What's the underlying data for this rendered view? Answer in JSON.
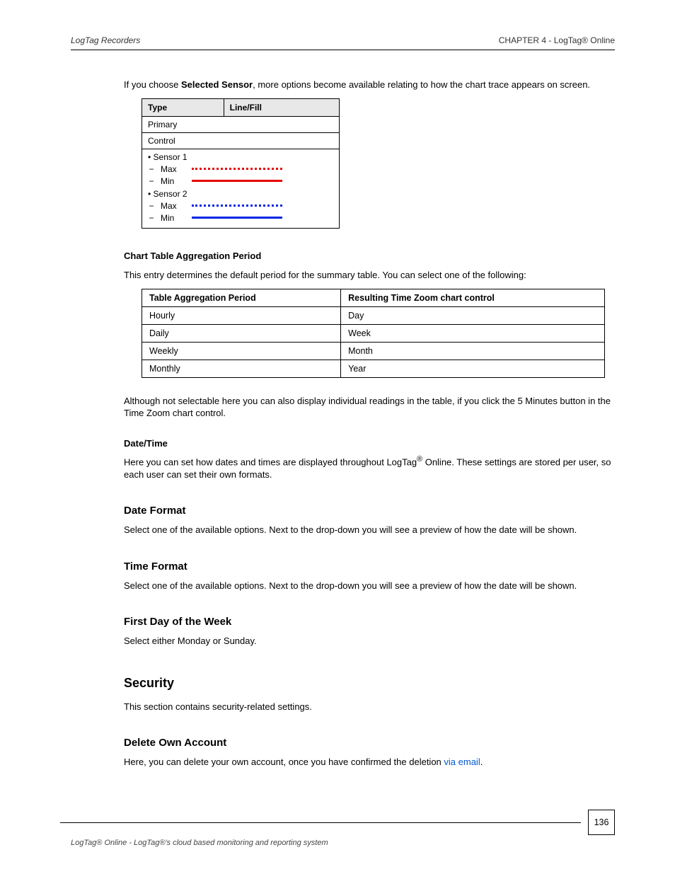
{
  "header": {
    "left": "LogTag Recorders",
    "right": "CHAPTER 4 - LogTag® Online"
  },
  "body": {
    "p1_prefix": "If you choose",
    "p1_bold": "Selected Sensor",
    "p1_suffix": ", more options become available relating to how the chart trace appears on screen.",
    "table1": {
      "header_type": "Type",
      "header_line": "Line/Fill",
      "row1": "Primary",
      "row2": "Control",
      "sensor1_label": "Sensor 1",
      "sub_max": "Max",
      "sub_min": "Min",
      "sensor2_label": "Sensor 2"
    },
    "bold_title1": "Chart Table Aggregation Period",
    "p2": "This entry determines the default period for the summary table. You can select one of the following:",
    "table2": {
      "h1": "Table Aggregation Period",
      "h2": "Resulting Time Zoom chart control",
      "rows": [
        [
          "Hourly",
          "Day"
        ],
        [
          "Daily",
          "Week"
        ],
        [
          "Weekly",
          "Month"
        ],
        [
          "Monthly",
          "Year"
        ]
      ]
    },
    "p3": "Although not selectable here you can also display individual readings in the table, if you click the 5 Minutes button in the Time Zoom chart control.",
    "bold_title2": "Date/Time",
    "p4_a": "Here you can set how dates and times are displayed throughout LogTag",
    "p4_sup": "®",
    "p4_b": " Online. These settings are stored per user, so each user can set their own formats.",
    "h3_1": "Date Format",
    "p5": "Select one of the available options. Next to the drop-down you will see a preview of how the date will be shown.",
    "h3_2": "Time Format",
    "p6": "Select one of the available options. Next to the drop-down you will see a preview of how the date will be shown.",
    "h3_3": "First Day of the Week",
    "p7": "Select either Monday or Sunday.",
    "h2_security": "Security",
    "p8": "This section contains security-related settings.",
    "h3_4": "Delete Own Account",
    "p9_a": "Here, you can delete your own account, once you have confirmed the deletion ",
    "p9_link": "via email"
  },
  "footer": {
    "page": "136",
    "text": "LogTag® Online - LogTag®'s cloud based monitoring and reporting system"
  }
}
